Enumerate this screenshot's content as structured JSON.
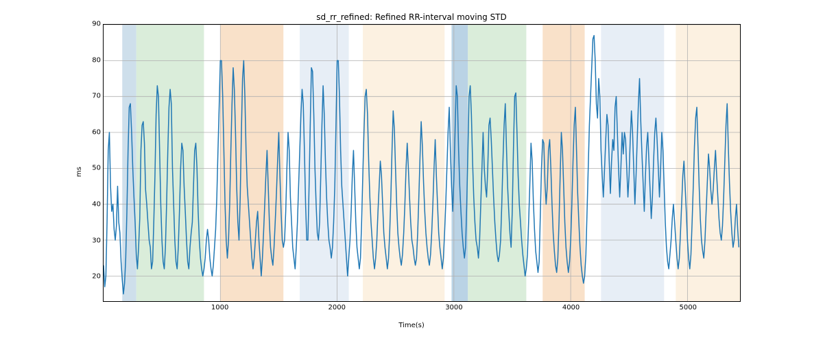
{
  "chart_data": {
    "type": "line",
    "title": "sd_rr_refined: Refined RR-interval moving STD",
    "xlabel": "Time(s)",
    "ylabel": "ms",
    "xlim": [
      0,
      5450
    ],
    "ylim": [
      13,
      90
    ],
    "xticks": [
      1000,
      2000,
      3000,
      4000,
      5000
    ],
    "yticks": [
      20,
      30,
      40,
      50,
      60,
      70,
      80,
      90
    ],
    "bands": [
      {
        "x0": 160,
        "x1": 280,
        "color": "#c6d9e8",
        "alpha": 0.85
      },
      {
        "x0": 280,
        "x1": 860,
        "color": "#d4ead4",
        "alpha": 0.85
      },
      {
        "x0": 1000,
        "x1": 1540,
        "color": "#f8dcc0",
        "alpha": 0.85
      },
      {
        "x0": 1680,
        "x1": 2100,
        "color": "#e3ebf4",
        "alpha": 0.85
      },
      {
        "x0": 2220,
        "x1": 2920,
        "color": "#fbeedc",
        "alpha": 0.85
      },
      {
        "x0": 2980,
        "x1": 3120,
        "color": "#aecbe0",
        "alpha": 0.85
      },
      {
        "x0": 3120,
        "x1": 3620,
        "color": "#d4ead4",
        "alpha": 0.85
      },
      {
        "x0": 3760,
        "x1": 4120,
        "color": "#f8dcc0",
        "alpha": 0.85
      },
      {
        "x0": 4260,
        "x1": 4800,
        "color": "#e3ebf4",
        "alpha": 0.85
      },
      {
        "x0": 4900,
        "x1": 5450,
        "color": "#fbeedc",
        "alpha": 0.85
      }
    ],
    "series": [
      {
        "name": "sd_rr_refined",
        "x_step": 10,
        "y": [
          23,
          17,
          20,
          35,
          55,
          60,
          45,
          38,
          40,
          33,
          30,
          34,
          45,
          35,
          32,
          24,
          19,
          15,
          18,
          25,
          38,
          55,
          67,
          68,
          60,
          50,
          42,
          35,
          26,
          22,
          28,
          36,
          55,
          62,
          63,
          57,
          44,
          40,
          35,
          30,
          28,
          22,
          24,
          35,
          48,
          65,
          73,
          70,
          55,
          40,
          30,
          24,
          22,
          28,
          40,
          55,
          67,
          72,
          68,
          50,
          40,
          30,
          24,
          22,
          28,
          38,
          50,
          57,
          55,
          45,
          38,
          30,
          24,
          22,
          28,
          32,
          35,
          45,
          55,
          57,
          50,
          38,
          30,
          25,
          22,
          20,
          22,
          25,
          30,
          33,
          30,
          25,
          22,
          20,
          23,
          28,
          33,
          42,
          55,
          67,
          80,
          80,
          70,
          55,
          40,
          30,
          25,
          30,
          40,
          55,
          68,
          78,
          72,
          60,
          45,
          35,
          30,
          42,
          60,
          75,
          80,
          70,
          55,
          45,
          40,
          35,
          30,
          25,
          22,
          25,
          30,
          35,
          38,
          30,
          25,
          20,
          25,
          32,
          40,
          48,
          55,
          45,
          35,
          28,
          25,
          23,
          28,
          35,
          43,
          52,
          60,
          48,
          38,
          30,
          28,
          30,
          38,
          50,
          60,
          55,
          42,
          35,
          28,
          25,
          22,
          28,
          35,
          45,
          55,
          65,
          72,
          68,
          55,
          40,
          30,
          30,
          45,
          62,
          78,
          77,
          65,
          50,
          40,
          32,
          30,
          35,
          48,
          62,
          73,
          65,
          52,
          42,
          35,
          30,
          28,
          25,
          28,
          35,
          45,
          62,
          80,
          80,
          70,
          55,
          45,
          40,
          35,
          30,
          25,
          20,
          25,
          30,
          38,
          48,
          55,
          45,
          35,
          28,
          25,
          22,
          25,
          35,
          48,
          60,
          70,
          72,
          65,
          52,
          42,
          35,
          30,
          25,
          22,
          25,
          30,
          38,
          45,
          52,
          48,
          40,
          32,
          28,
          25,
          22,
          25,
          32,
          42,
          55,
          66,
          61,
          50,
          40,
          32,
          28,
          25,
          23,
          26,
          32,
          40,
          50,
          57,
          50,
          42,
          35,
          30,
          28,
          25,
          23,
          25,
          32,
          42,
          53,
          63,
          56,
          46,
          38,
          32,
          28,
          25,
          23,
          26,
          32,
          40,
          50,
          58,
          48,
          40,
          32,
          28,
          25,
          22,
          25,
          32,
          40,
          50,
          60,
          67,
          55,
          45,
          38,
          47,
          60,
          73,
          70,
          55,
          45,
          38,
          32,
          28,
          25,
          28,
          40,
          55,
          70,
          73,
          65,
          52,
          42,
          35,
          30,
          28,
          25,
          30,
          40,
          50,
          60,
          50,
          45,
          42,
          50,
          62,
          64,
          58,
          50,
          42,
          35,
          30,
          26,
          24,
          26,
          30,
          40,
          52,
          62,
          68,
          56,
          45,
          38,
          32,
          28,
          38,
          56,
          70,
          71,
          60,
          48,
          40,
          35,
          30,
          26,
          23,
          20,
          22,
          26,
          35,
          45,
          57,
          52,
          41,
          33,
          27,
          24,
          21,
          24,
          37,
          50,
          58,
          57,
          46,
          40,
          45,
          55,
          58,
          50,
          40,
          32,
          27,
          23,
          21,
          25,
          35,
          48,
          60,
          55,
          45,
          35,
          28,
          24,
          21,
          24,
          30,
          40,
          52,
          62,
          67,
          55,
          43,
          35,
          28,
          23,
          20,
          18,
          20,
          26,
          38,
          50,
          62,
          70,
          78,
          86,
          87,
          80,
          68,
          64,
          75,
          70,
          55,
          48,
          42,
          50,
          58,
          65,
          62,
          52,
          43,
          52,
          58,
          55,
          67,
          70,
          60,
          50,
          42,
          50,
          60,
          54,
          60,
          58,
          50,
          42,
          48,
          58,
          66,
          60,
          50,
          40,
          48,
          58,
          68,
          75,
          63,
          54,
          46,
          38,
          48,
          56,
          60,
          52,
          44,
          36,
          42,
          52,
          60,
          64,
          58,
          50,
          42,
          50,
          60,
          55,
          45,
          35,
          28,
          24,
          22,
          26,
          30,
          36,
          40,
          35,
          30,
          25,
          22,
          25,
          32,
          40,
          48,
          52,
          45,
          38,
          30,
          25,
          22,
          26,
          35,
          45,
          56,
          64,
          67,
          56,
          45,
          36,
          30,
          27,
          25,
          30,
          38,
          46,
          54,
          50,
          44,
          40,
          44,
          50,
          55,
          48,
          42,
          36,
          32,
          30,
          34,
          42,
          52,
          62,
          68,
          56,
          46,
          38,
          32,
          28,
          30,
          36,
          40,
          33,
          28
        ]
      }
    ]
  }
}
